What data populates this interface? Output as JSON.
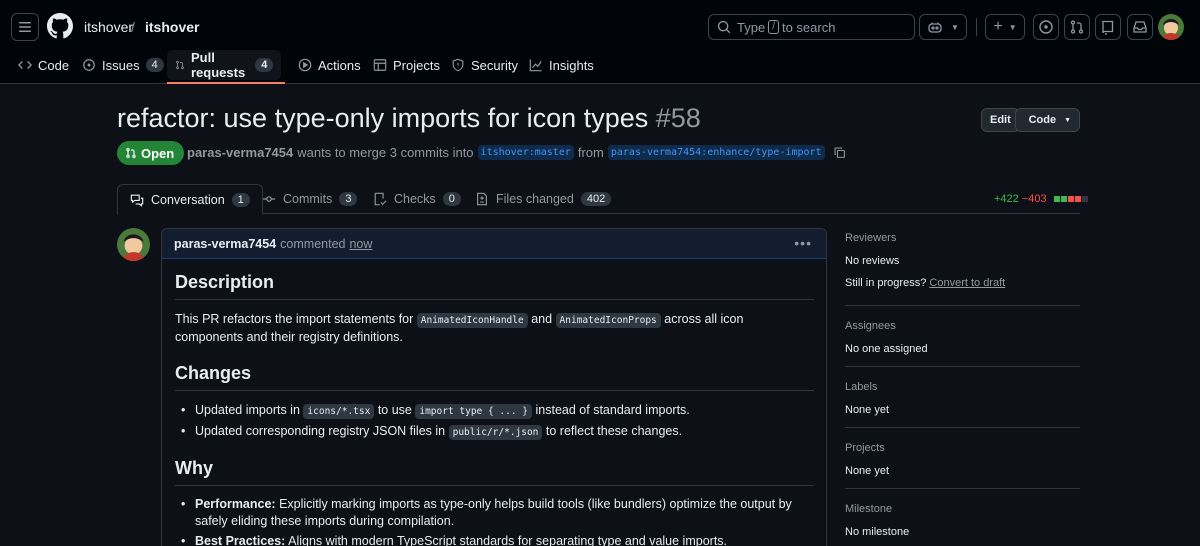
{
  "header": {
    "owner": "itshover",
    "repo": "itshover",
    "search_prefix": "Type",
    "search_key": "/",
    "search_suffix": "to search"
  },
  "tabs": [
    {
      "label": "Code",
      "icon": "code-icon"
    },
    {
      "label": "Issues",
      "count": "4",
      "icon": "issue-icon"
    },
    {
      "label": "Pull requests",
      "count": "4",
      "icon": "pull-request-icon"
    },
    {
      "label": "Actions",
      "icon": "play-icon"
    },
    {
      "label": "Projects",
      "icon": "table-icon"
    },
    {
      "label": "Security",
      "icon": "shield-icon"
    },
    {
      "label": "Insights",
      "icon": "graph-icon"
    }
  ],
  "pr": {
    "title": "refactor: use type-only imports for icon types",
    "number": "#58",
    "state": "Open",
    "author": "paras-verma7454",
    "merge_text_1": "wants to merge 3 commits into",
    "base_branch": "itshover:master",
    "from": "from",
    "head_branch": "paras-verma7454:enhance/type-import",
    "edit_label": "Edit",
    "code_label": "Code"
  },
  "pr_tabs": [
    {
      "label": "Conversation",
      "count": "1"
    },
    {
      "label": "Commits",
      "count": "3"
    },
    {
      "label": "Checks",
      "count": "0"
    },
    {
      "label": "Files changed",
      "count": "402"
    }
  ],
  "diffstat": {
    "additions": "+422",
    "deletions": "−403"
  },
  "comment": {
    "author": "paras-verma7454",
    "action": "commented",
    "time": "now",
    "description_heading": "Description",
    "description_1": "This PR refactors the import statements for",
    "code_handle": "AnimatedIconHandle",
    "and": "and",
    "code_props": "AnimatedIconProps",
    "description_2": "across all icon components and their registry definitions.",
    "changes_heading": "Changes",
    "change_1_a": "Updated imports in",
    "change_1_code_a": "icons/*.tsx",
    "change_1_b": "to use",
    "change_1_code_b": "import type { ... }",
    "change_1_c": "instead of standard imports.",
    "change_2_a": "Updated corresponding registry JSON files in",
    "change_2_code": "public/r/*.json",
    "change_2_b": "to reflect these changes.",
    "why_heading": "Why",
    "why_1_label": "Performance:",
    "why_1_text": "Explicitly marking imports as type-only helps build tools (like bundlers) optimize the output by safely eliding these imports during compilation.",
    "why_2_label": "Best Practices:",
    "why_2_text": "Aligns with modern TypeScript standards for separating type and value imports."
  },
  "sidebar": {
    "reviewers_title": "Reviewers",
    "reviewers_value": "No reviews",
    "in_progress": "Still in progress?",
    "convert_draft": "Convert to draft",
    "assignees_title": "Assignees",
    "assignees_value": "No one assigned",
    "labels_title": "Labels",
    "labels_value": "None yet",
    "projects_title": "Projects",
    "projects_value": "None yet",
    "milestone_title": "Milestone",
    "milestone_value": "No milestone"
  },
  "colors": {
    "accent": "#f78166",
    "open": "#238636",
    "link": "#4493f8",
    "add": "#3fb950",
    "del": "#f85149"
  }
}
